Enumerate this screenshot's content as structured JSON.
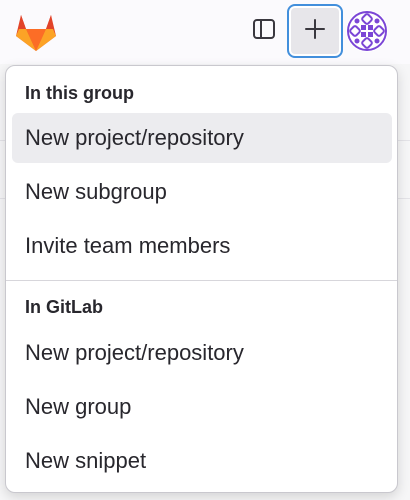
{
  "header": {
    "logo_icon": "gitlab-tanuki-icon",
    "sidebar_toggle_icon": "sidebar-toggle-icon",
    "create_new_icon": "plus-icon",
    "avatar_icon": "user-avatar-identicon"
  },
  "colors": {
    "focus_ring": "#428fdc",
    "avatar_purple": "#7b46d6",
    "highlight": "#ececef"
  },
  "dropdown": {
    "groups": [
      {
        "heading": "In this group",
        "items": [
          {
            "label": "New project/repository",
            "highlighted": true
          },
          {
            "label": "New subgroup",
            "highlighted": false
          },
          {
            "label": "Invite team members",
            "highlighted": false
          }
        ]
      },
      {
        "heading": "In GitLab",
        "items": [
          {
            "label": "New project/repository",
            "highlighted": false
          },
          {
            "label": "New group",
            "highlighted": false
          },
          {
            "label": "New snippet",
            "highlighted": false
          }
        ]
      }
    ]
  }
}
